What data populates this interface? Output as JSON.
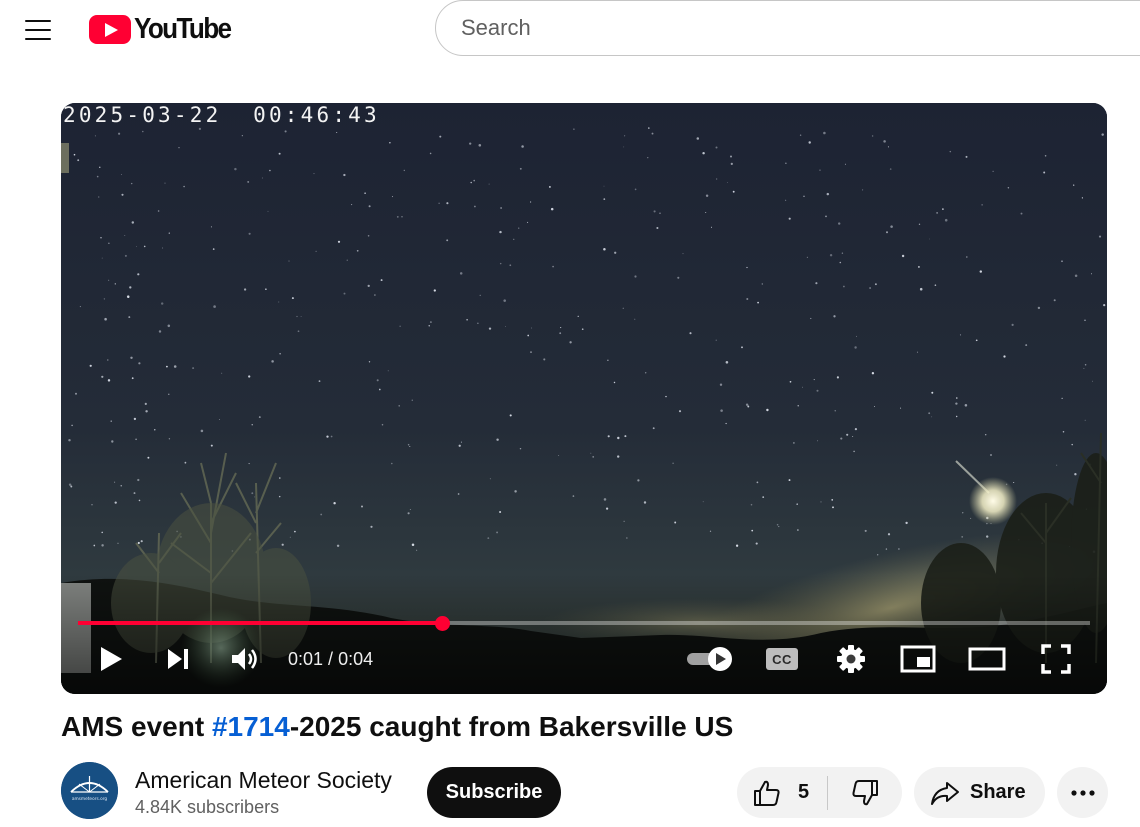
{
  "header": {
    "menu_icon": "hamburger-menu-icon",
    "logo_text": "YouTube",
    "search_placeholder": "Search"
  },
  "player": {
    "overlay_timestamp": "2025-03-22  00:46:43",
    "current_time": "0:01",
    "duration": "0:04",
    "time_separator": " / ",
    "progress_fraction": 0.36,
    "progress_color": "#ff0033",
    "controls": {
      "play": "play-icon",
      "next": "next-icon",
      "volume": "volume-icon",
      "autoplay": "autoplay-toggle-icon",
      "captions": "CC",
      "settings": "gear-icon",
      "miniplayer": "miniplayer-icon",
      "theater": "theater-mode-icon",
      "fullscreen": "fullscreen-icon"
    }
  },
  "video": {
    "title_prefix": "AMS event ",
    "title_link": "#1714",
    "title_suffix": "-2025 caught from Bakersville US",
    "link_color": "#065fd4"
  },
  "channel": {
    "name": "American Meteor Society",
    "subscribers": "4.84K subscribers",
    "avatar_text": "amsmeteors.org",
    "subscribe_label": "Subscribe"
  },
  "actions": {
    "like_count": "5",
    "share_label": "Share",
    "more_icon": "more-horizontal-icon"
  }
}
